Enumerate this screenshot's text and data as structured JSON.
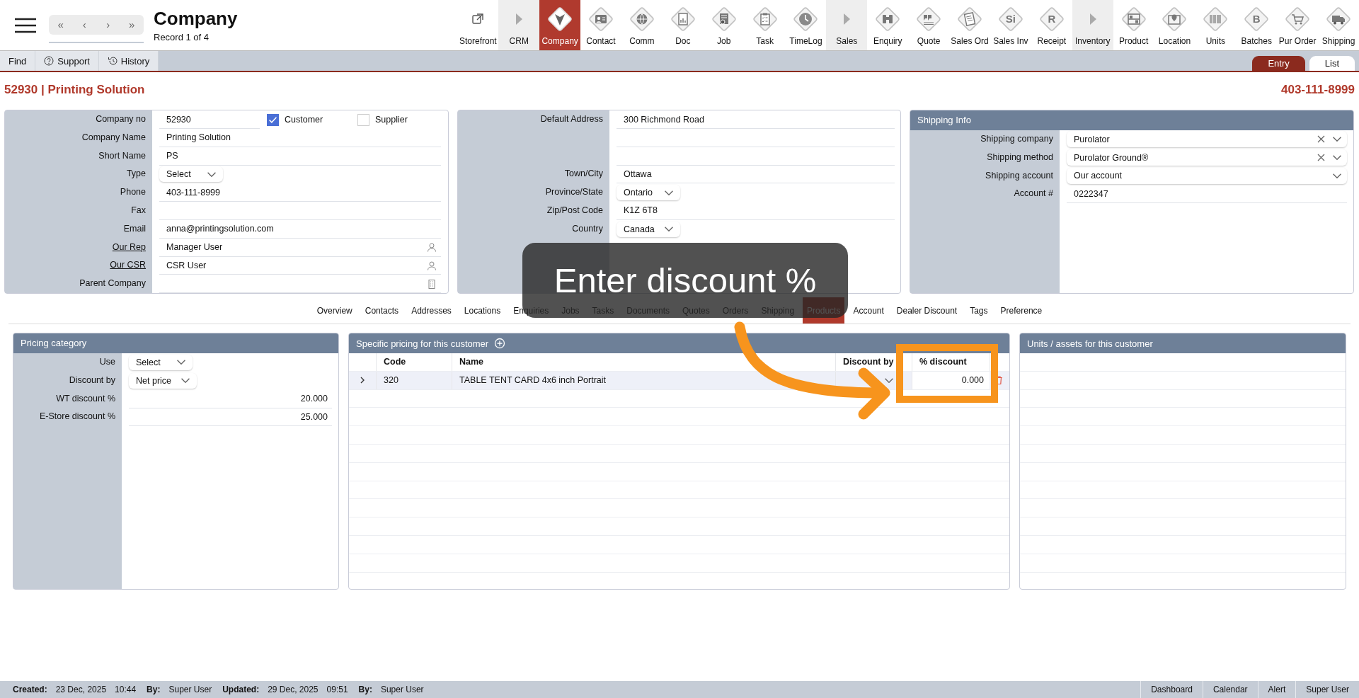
{
  "toolbar": {
    "title": "Company",
    "record": "Record 1 of 4",
    "nav": [
      "«",
      "‹",
      "›",
      "»"
    ],
    "modules": [
      {
        "label": "Storefront",
        "kind": "link",
        "selected": false
      },
      {
        "label": "CRM",
        "kind": "section",
        "selected": false
      },
      {
        "label": "Company",
        "kind": "module",
        "selected": true
      },
      {
        "label": "Contact",
        "kind": "module",
        "selected": false
      },
      {
        "label": "Comm",
        "kind": "module",
        "selected": false
      },
      {
        "label": "Doc",
        "kind": "module",
        "selected": false
      },
      {
        "label": "Job",
        "kind": "module",
        "selected": false
      },
      {
        "label": "Task",
        "kind": "module",
        "selected": false
      },
      {
        "label": "TimeLog",
        "kind": "module",
        "selected": false
      },
      {
        "label": "Sales",
        "kind": "section",
        "selected": false
      },
      {
        "label": "Enquiry",
        "kind": "module",
        "selected": false
      },
      {
        "label": "Quote",
        "kind": "module",
        "selected": false
      },
      {
        "label": "Sales Ord",
        "kind": "module",
        "selected": false
      },
      {
        "label": "Sales Inv",
        "kind": "module",
        "selected": false,
        "glyph": "Si"
      },
      {
        "label": "Receipt",
        "kind": "module",
        "selected": false,
        "glyph": "R"
      },
      {
        "label": "Inventory",
        "kind": "section",
        "selected": false
      },
      {
        "label": "Product",
        "kind": "module",
        "selected": false
      },
      {
        "label": "Location",
        "kind": "module",
        "selected": false
      },
      {
        "label": "Units",
        "kind": "module",
        "selected": false
      },
      {
        "label": "Batches",
        "kind": "module",
        "selected": false,
        "glyph": "B"
      },
      {
        "label": "Pur Order",
        "kind": "module",
        "selected": false
      },
      {
        "label": "Shipping",
        "kind": "module",
        "selected": false
      }
    ]
  },
  "subbar": {
    "buttons": [
      "Find",
      "Support",
      "History"
    ],
    "views": [
      {
        "label": "Entry",
        "selected": true
      },
      {
        "label": "List",
        "selected": false
      }
    ]
  },
  "record": {
    "heading": "52930 | Printing Solution",
    "phone": "403-111-8999"
  },
  "panels": [
    {
      "fields": [
        {
          "label": "Company no",
          "kind": "id_checks",
          "value": "52930",
          "checks": [
            {
              "label": "Customer",
              "checked": true
            },
            {
              "label": "Supplier",
              "checked": false
            }
          ]
        },
        {
          "label": "Company Name",
          "kind": "text",
          "value": "Printing Solution"
        },
        {
          "label": "Short Name",
          "kind": "text",
          "value": "PS"
        },
        {
          "label": "Type",
          "kind": "select",
          "value": "Select"
        },
        {
          "label": "Phone",
          "kind": "text",
          "value": "403-111-8999"
        },
        {
          "label": "Fax",
          "kind": "text"
        },
        {
          "label": "Email",
          "kind": "text",
          "value": "anna@printingsolution.com"
        },
        {
          "label": "Our Rep",
          "kind": "person",
          "value": "Manager User"
        },
        {
          "label": "Our CSR",
          "kind": "person",
          "value": "CSR User"
        },
        {
          "label": "Parent Company",
          "kind": "building"
        }
      ]
    },
    {
      "fields": [
        {
          "label": "Default Address",
          "kind": "text",
          "value": "300 Richmond Road"
        },
        {
          "kind": "text"
        },
        {
          "kind": "text"
        },
        {
          "label": "Town/City",
          "kind": "text",
          "value": "Ottawa"
        },
        {
          "label": "Province/State",
          "kind": "select",
          "value": "Ontario"
        },
        {
          "label": "Zip/Post Code",
          "kind": "text",
          "value": "K1Z 6T8"
        },
        {
          "label": "Country",
          "kind": "select",
          "value": "Canada"
        }
      ]
    },
    {
      "title": "Shipping Info",
      "fields": [
        {
          "label": "Shipping company",
          "kind": "combo",
          "value": "Purolator",
          "clearable": true
        },
        {
          "label": "Shipping method",
          "kind": "combo",
          "value": "Purolator Ground®",
          "clearable": true
        },
        {
          "label": "Shipping account",
          "kind": "combo",
          "value": "Our account",
          "clearable": false
        },
        {
          "label": "Account #",
          "kind": "text",
          "value": "0222347"
        }
      ]
    }
  ],
  "detail_tabs": [
    {
      "label": "Overview",
      "selected": false
    },
    {
      "label": "Contacts",
      "selected": false
    },
    {
      "label": "Addresses",
      "selected": false
    },
    {
      "label": "Locations",
      "selected": false
    },
    {
      "label": "Enquiries",
      "selected": false
    },
    {
      "label": "Jobs",
      "selected": false
    },
    {
      "label": "Tasks",
      "selected": false
    },
    {
      "label": "Documents",
      "selected": false
    },
    {
      "label": "Quotes",
      "selected": false
    },
    {
      "label": "Orders",
      "selected": false
    },
    {
      "label": "Shipping",
      "selected": false
    },
    {
      "label": "Products",
      "selected": true
    },
    {
      "label": "Account",
      "selected": false
    },
    {
      "label": "Dealer Discount",
      "selected": false
    },
    {
      "label": "Tags",
      "selected": false
    },
    {
      "label": "Preference",
      "selected": false
    }
  ],
  "pricing_category": {
    "title": "Pricing category",
    "fields": [
      {
        "label": "Use",
        "kind": "select",
        "value": "Select"
      },
      {
        "label": "Discount by",
        "kind": "select",
        "value": "Net price"
      },
      {
        "label": "WT discount %",
        "kind": "number",
        "value": "20.000"
      },
      {
        "label": "E-Store discount %",
        "kind": "number",
        "value": "25.000"
      }
    ]
  },
  "specific_pricing": {
    "title": "Specific pricing for this customer",
    "columns": [
      "Code",
      "Name",
      "Discount by",
      "% discount"
    ],
    "rows": [
      {
        "expanded": false,
        "code": "320",
        "name": "TABLE TENT CARD 4x6 inch Portrait",
        "discount": "0.000"
      }
    ]
  },
  "units_panel": {
    "title": "Units / assets for this customer"
  },
  "callout": {
    "text": "Enter discount %"
  },
  "footer": {
    "audit": [
      {
        "label": "Created:",
        "parts": [
          "23 Dec, 2025",
          "10:44"
        ]
      },
      {
        "label": "By:",
        "parts": [
          "Super User"
        ]
      },
      {
        "label": "Updated:",
        "parts": [
          "29 Dec, 2025",
          "09:51"
        ]
      },
      {
        "label": "By:",
        "parts": [
          "Super User"
        ]
      }
    ],
    "links": [
      "Dashboard",
      "Calendar",
      "Alert",
      "Super User"
    ]
  }
}
